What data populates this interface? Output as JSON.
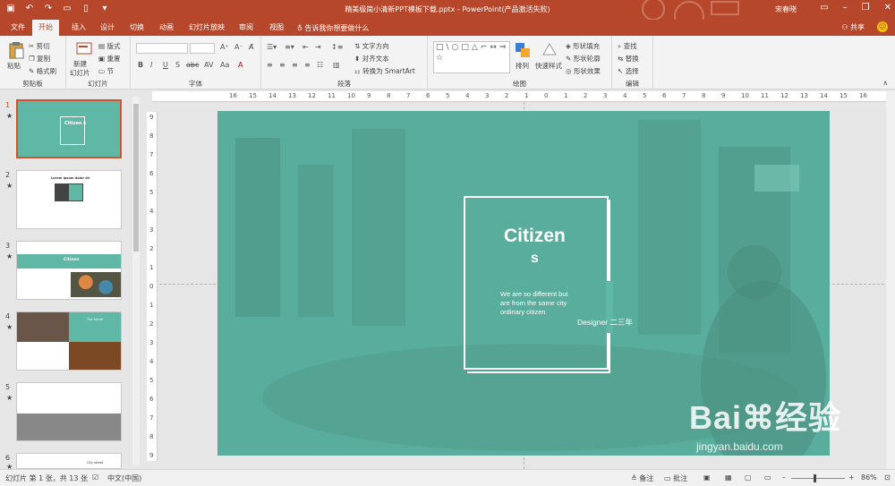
{
  "titlebar": {
    "title": "精美极简小清新PPT模板下载.pptx  -  PowerPoint(产品激活失败)",
    "user": "宋春晓",
    "qat_icons": [
      "save-icon",
      "undo-icon",
      "redo-icon",
      "start-from-beginning-icon",
      "new-file-icon",
      "customize-qat-icon"
    ],
    "window_controls": [
      "ribbon-options-icon",
      "minimize-icon",
      "restore-icon",
      "close-icon"
    ]
  },
  "tabs": [
    "文件",
    "开始",
    "插入",
    "设计",
    "切换",
    "动画",
    "幻灯片放映",
    "审阅",
    "视图"
  ],
  "active_tab": "开始",
  "tell_me": "告诉我你想要做什么",
  "share": "共享",
  "ribbon": {
    "clipboard": {
      "label": "剪贴板",
      "paste": "粘贴",
      "cut": "剪切",
      "copy": "复制",
      "format_painter": "格式刷"
    },
    "slides": {
      "label": "幻灯片",
      "new_slide_1": "新建",
      "new_slide_2": "幻灯片",
      "layout": "版式",
      "reset": "重置",
      "section": "节"
    },
    "font": {
      "label": "字体",
      "font_name": "",
      "font_size": "",
      "bold": "B",
      "italic": "I",
      "underline": "U",
      "shadow": "S",
      "strike": "abc",
      "spacing": "AV",
      "case": "Aa",
      "color": "A"
    },
    "paragraph": {
      "label": "段落",
      "text_direction": "文字方向",
      "align_text": "对齐文本",
      "smartart": "转换为 SmartArt"
    },
    "drawing": {
      "label": "绘图",
      "shapes_preview": "□\\○□△⌐↔⇒⇩⌒{}☆",
      "arrange": "排列",
      "quick_styles": "快速样式",
      "shape_fill": "形状填充",
      "shape_outline": "形状轮廓",
      "shape_effects": "形状效果"
    },
    "editing": {
      "label": "编辑",
      "find": "查找",
      "replace": "替换",
      "select": "选择"
    }
  },
  "ruler_ticks": [
    "16",
    "15",
    "14",
    "13",
    "12",
    "11",
    "10",
    "9",
    "8",
    "7",
    "6",
    "5",
    "4",
    "3",
    "2",
    "1",
    "0",
    "1",
    "2",
    "3",
    "4",
    "5",
    "6",
    "7",
    "8",
    "9",
    "10",
    "11",
    "12",
    "13",
    "14",
    "15",
    "16"
  ],
  "vruler_ticks": [
    "9",
    "8",
    "7",
    "6",
    "5",
    "4",
    "3",
    "2",
    "1",
    "0",
    "1",
    "2",
    "3",
    "4",
    "5",
    "6",
    "7",
    "8",
    "9"
  ],
  "thumbnails": [
    {
      "num": "1",
      "star": "★",
      "title": "Citizen s"
    },
    {
      "num": "2",
      "star": "★",
      "title": "Lorem ipsum dolor sit"
    },
    {
      "num": "3",
      "star": "★",
      "title": "Citizen"
    },
    {
      "num": "4",
      "star": "★",
      "title": "The future"
    },
    {
      "num": "5",
      "star": "★",
      "title": ""
    },
    {
      "num": "6",
      "star": "★",
      "title": "City street"
    }
  ],
  "slide": {
    "title_line1": "Citizen",
    "title_line2": "s",
    "description": "We are so different but are from the same city ordinary citizen",
    "designer": "Designer    二三年",
    "bg_color": "#5fb7a5"
  },
  "watermark": {
    "main": "Bai⌘经验",
    "sub": "jingyan.baidu.com"
  },
  "status": {
    "slide_info": "幻灯片 第 1 张，共 13 张",
    "language": "中文(中国)",
    "notes": "备注",
    "comments": "批注",
    "zoom": "86%"
  },
  "colors": {
    "accent": "#b7472a",
    "slide_teal": "#5fb7a5"
  }
}
